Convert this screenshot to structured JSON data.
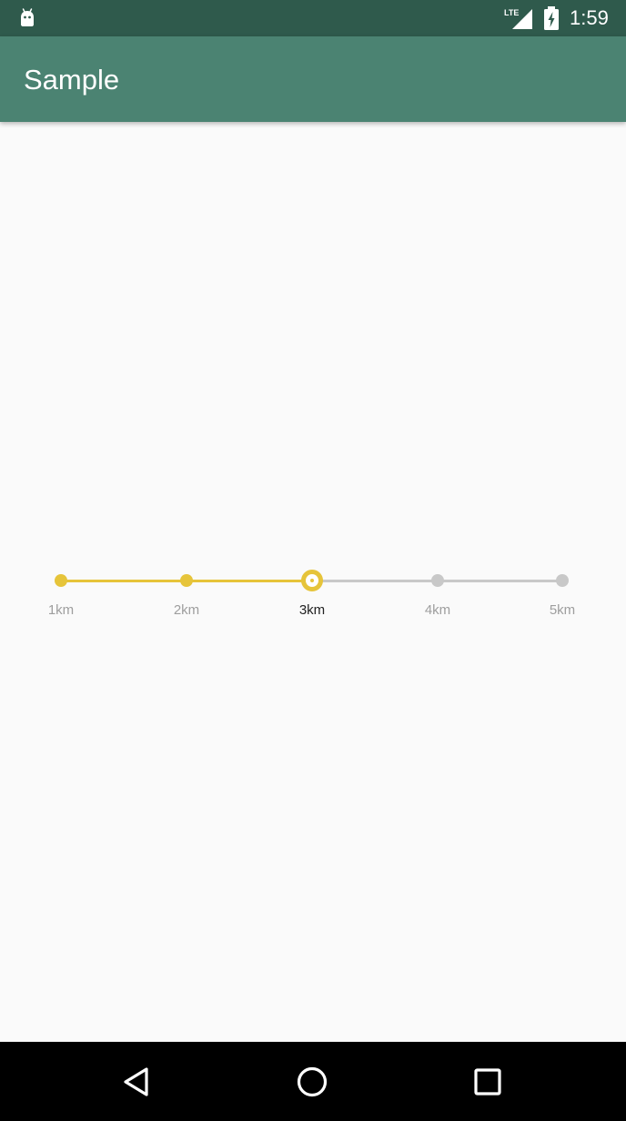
{
  "status_bar": {
    "time": "1:59",
    "network": "LTE",
    "icons": [
      "android-debug-icon",
      "lte-signal-icon",
      "battery-charging-icon"
    ]
  },
  "app_bar": {
    "title": "Sample"
  },
  "stepper": {
    "steps": [
      {
        "label": "1km",
        "state": "done"
      },
      {
        "label": "2km",
        "state": "done"
      },
      {
        "label": "3km",
        "state": "current"
      },
      {
        "label": "4km",
        "state": "todo"
      },
      {
        "label": "5km",
        "state": "todo"
      }
    ],
    "selected_index": 2,
    "colors": {
      "active": "#e6c43a",
      "inactive": "#c8c8c8",
      "label": "#9e9e9e",
      "label_current": "#222222"
    }
  },
  "nav_bar": {
    "buttons": [
      "back-icon",
      "home-icon",
      "recents-icon"
    ]
  },
  "colors": {
    "status_bar": "#2f5a4c",
    "app_bar": "#4b8372",
    "background": "#fafafa",
    "nav_bar": "#000000"
  }
}
